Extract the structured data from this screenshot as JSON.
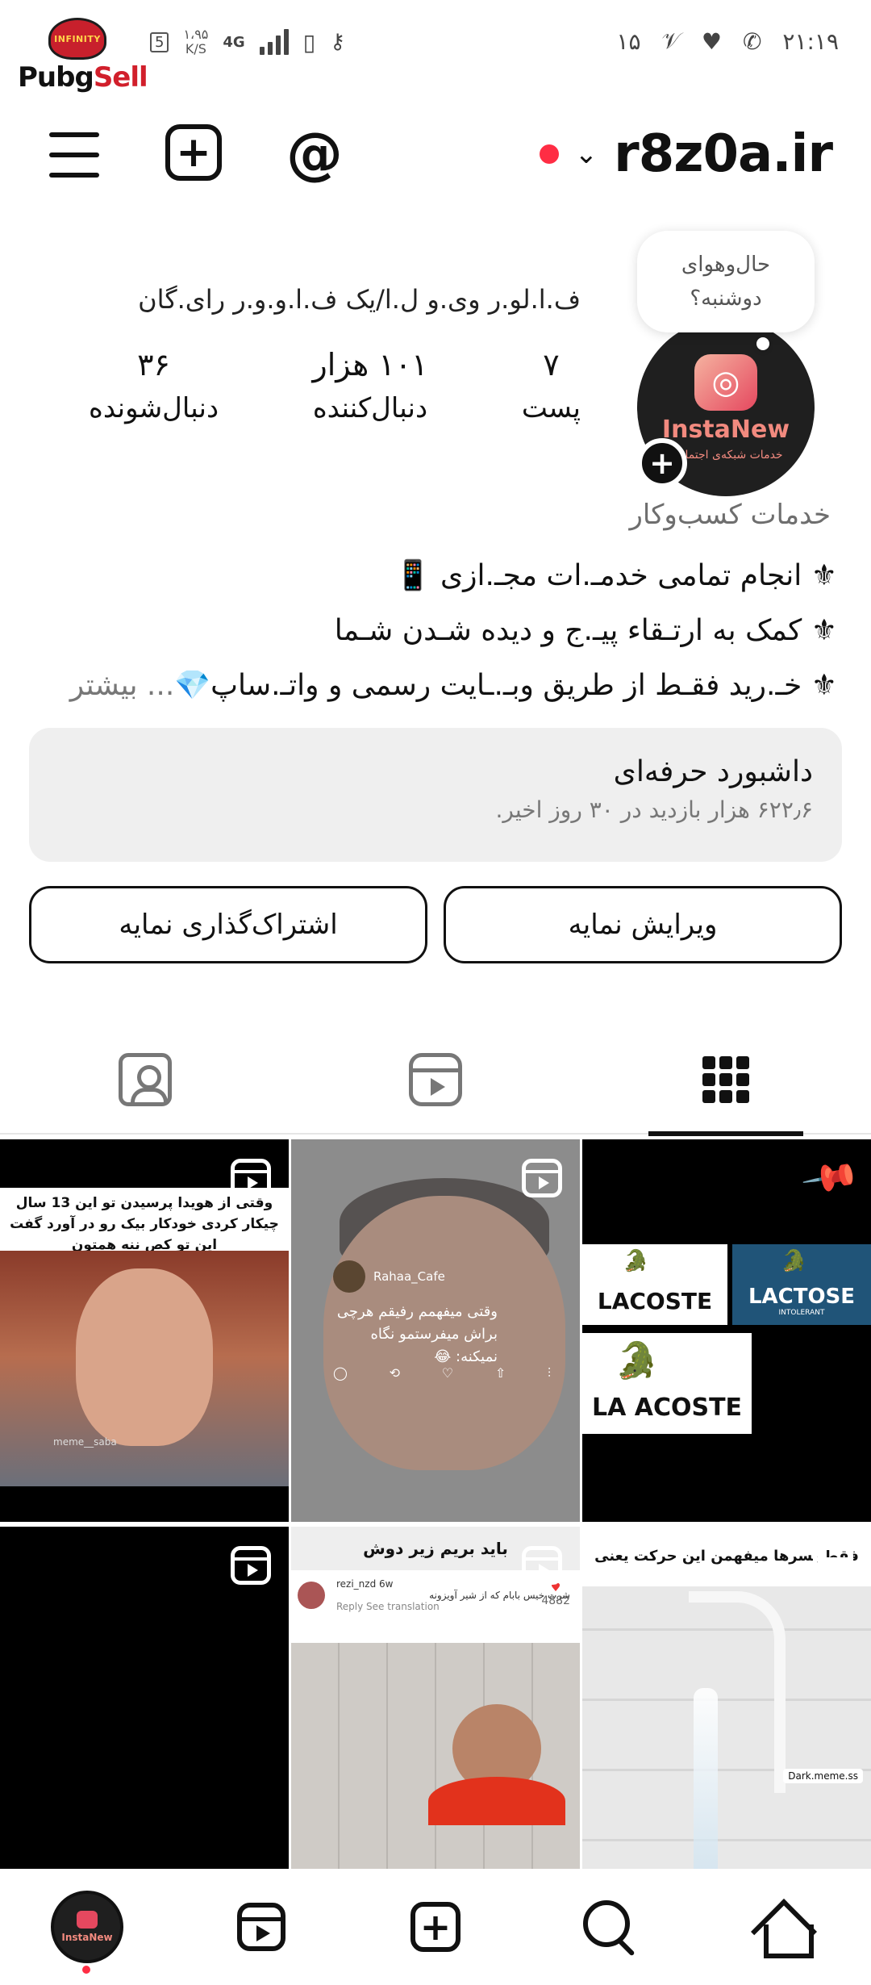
{
  "status_bar": {
    "brand_badge": "INFINITY",
    "brand_word_a": "Pubg",
    "brand_word_b": "Sell",
    "sim_label": "5",
    "net_speed_value": "۱،۹۵",
    "net_speed_unit": "K/S",
    "network": "4G",
    "notifications": [
      "۱۵",
      "𝒱"
    ],
    "time": "۲۱:۱۹"
  },
  "appbar": {
    "account_name": "r8z0a.ir"
  },
  "profile": {
    "note_text": "حال‌وهوای دوشنبه؟",
    "avatar_brand": "InstaNew",
    "avatar_sub": "خدمات شبکه‌ی اجتماعی",
    "full_name": "ف.ا.لو.ر وی.و ل.ا/یک ف.ا.و.و.ر رای.گان",
    "stats": [
      {
        "value": "۷",
        "label": "پست"
      },
      {
        "value": "۱۰۱ هزار",
        "label": "دنبال‌کننده"
      },
      {
        "value": "۳۶",
        "label": "دنبال‌شونده"
      }
    ],
    "category": "خدمات کسب‌وکار",
    "bio_lines": [
      "⚜ انجام تمامی خدمـ.ات مجـ.ازی 📱",
      "⚜ کمک به ارتـقاء پیـ.ج و دیده شـدن شـما",
      "⚜ خـ.رید فقـط از طریق وبـ.ـایت رسمی و واتـ.ساپ💎"
    ],
    "bio_more": "... بیشتر"
  },
  "dashboard": {
    "title": "داشبورد حرفه‌ای",
    "subtitle": "۶۲۲٫۶ هزار بازدید در ۳۰ روز اخیر."
  },
  "buttons": {
    "edit": "ویرایش نمایه",
    "share": "اشتراک‌گذاری نمایه"
  },
  "posts": {
    "p1_caption": "وقتی از هویدا پرسیدن تو این 13 سال چیکار کردی خودکار بیک رو در آورد گفت این تو کص ننه همتون",
    "p1_watermark": "meme__saba",
    "p2_user": "Rahaa_Cafe",
    "p2_text": "وقتی میفهمم رفیقم هرچی براش میفرستمو نگاه نمیکنه: 😂",
    "p3_logo_1": "LACOSTE",
    "p3_logo_2": "LACTOSE",
    "p3_logo_2_sub": "INTOLERANT",
    "p3_logo_3": "LA ACOSTE",
    "p5_title": "باید بریم زیر دوش",
    "p5_comment_user": "rezi_nzd  6w",
    "p5_comment_text": "شرت خیس بابام که از شیر آویزونه",
    "p5_comment_actions": "Reply    See translation",
    "p5_likes": "4882",
    "p6_title": "فقط پسرها میفهمن این حرکت یعنی چی !!",
    "p6_watermark": "Dark.meme.ss"
  },
  "bottom_nav": {
    "profile_label": "InstaNew"
  }
}
